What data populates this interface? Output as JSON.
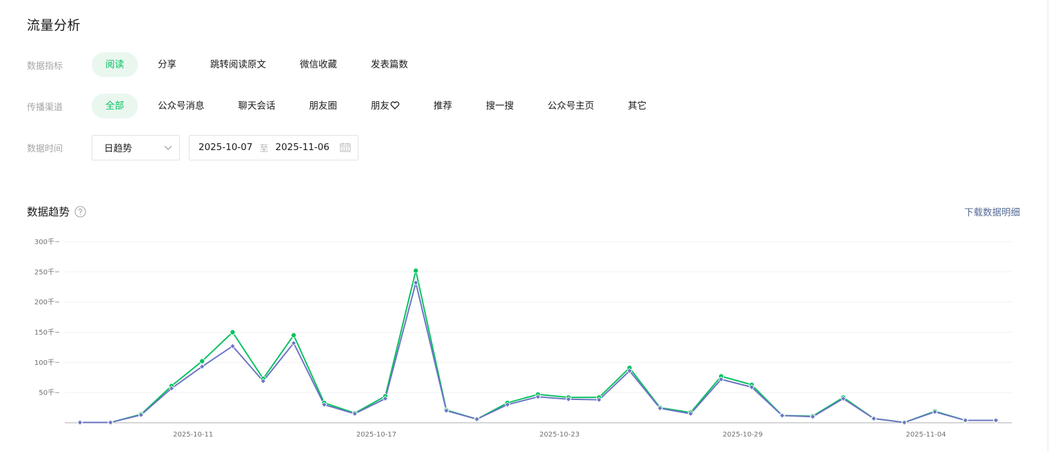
{
  "page": {
    "title": "流量分析"
  },
  "filters": {
    "metric": {
      "label": "数据指标",
      "options": [
        "阅读",
        "分享",
        "跳转阅读原文",
        "微信收藏",
        "发表篇数"
      ],
      "selected": "阅读"
    },
    "channel": {
      "label": "传播渠道",
      "options": [
        "全部",
        "公众号消息",
        "聊天会话",
        "朋友圈",
        "朋友",
        "推荐",
        "搜一搜",
        "公众号主页",
        "其它"
      ],
      "selected": "全部"
    },
    "time": {
      "label": "数据时间",
      "granularity": "日趋势",
      "start": "2025-10-07",
      "separator": "至",
      "end": "2025-11-06"
    }
  },
  "section": {
    "title": "数据趋势",
    "download_label": "下载数据明细"
  },
  "icons": {
    "dropdown": "chevron-down-icon",
    "calendar": "calendar-icon",
    "help": "question-circle-icon",
    "heart": "heart-icon"
  },
  "colors": {
    "accent": "#07c160",
    "accent_bg": "#e9f7ef",
    "series_green": "#07c160",
    "series_purple": "#6b74c4",
    "link": "#576b95"
  },
  "chart_data": {
    "type": "line",
    "x": [
      "2025-10-07",
      "2025-10-08",
      "2025-10-09",
      "2025-10-10",
      "2025-10-11",
      "2025-10-12",
      "2025-10-13",
      "2025-10-14",
      "2025-10-15",
      "2025-10-16",
      "2025-10-17",
      "2025-10-18",
      "2025-10-19",
      "2025-10-20",
      "2025-10-21",
      "2025-10-22",
      "2025-10-23",
      "2025-10-24",
      "2025-10-25",
      "2025-10-26",
      "2025-10-27",
      "2025-10-28",
      "2025-10-29",
      "2025-10-30",
      "2025-10-31",
      "2025-11-01",
      "2025-11-02",
      "2025-11-03",
      "2025-11-04",
      "2025-11-05",
      "2025-11-06"
    ],
    "x_tick_labels": [
      "2025-10-11",
      "2025-10-17",
      "2025-10-23",
      "2025-10-29",
      "2025-11-04"
    ],
    "y_tick_labels": [
      "50千",
      "100千",
      "150千",
      "200千",
      "250千",
      "300千"
    ],
    "y_ticks": [
      50,
      100,
      150,
      200,
      250,
      300
    ],
    "ylim": [
      0,
      300
    ],
    "y_unit": "千",
    "grid": true,
    "legend": "none",
    "series": [
      {
        "color": "#07c160",
        "marker": "circle",
        "values": [
          0.5,
          0.5,
          14,
          61,
          102,
          150,
          73,
          145,
          33,
          16,
          44,
          252,
          21,
          6,
          33,
          47,
          42,
          42,
          91,
          25,
          17,
          77,
          63,
          12,
          11,
          42,
          7,
          0.5,
          19,
          4,
          4
        ]
      },
      {
        "color": "#6b74c4",
        "marker": "diamond",
        "values": [
          0.5,
          0.5,
          13,
          57,
          93,
          127,
          69,
          132,
          30,
          15,
          40,
          232,
          20,
          6,
          30,
          43,
          39,
          38,
          86,
          24,
          15,
          72,
          59,
          12,
          10,
          40,
          7,
          0.5,
          18,
          4,
          4
        ]
      }
    ]
  }
}
